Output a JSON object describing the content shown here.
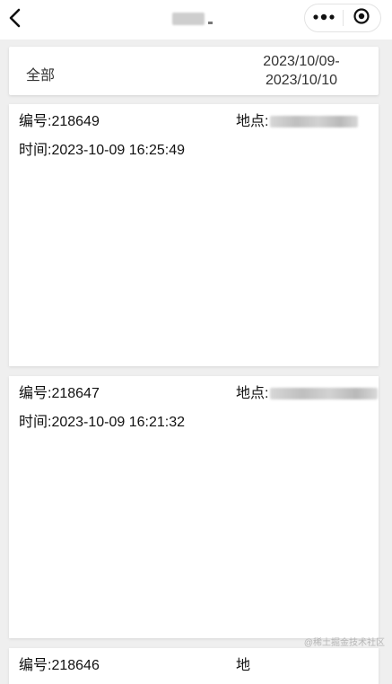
{
  "nav": {
    "back_icon": "chevron-left-icon",
    "title": "",
    "more_icon": "more-dots-icon",
    "close_icon": "target-circle-icon"
  },
  "filter": {
    "all_label": "全部",
    "date_range": "2023/10/09-\n2023/10/10"
  },
  "records": [
    {
      "no": "编号:218649",
      "location": "地点:",
      "time": "时间:2023-10-09 16:25:49"
    },
    {
      "no": "编号:218647",
      "location": "地点:",
      "time": "时间:2023-10-09 16:21:32"
    }
  ],
  "partial_record": {
    "no": "编号:218646",
    "location": "地"
  },
  "watermark": "@稀土掘金技术社区"
}
